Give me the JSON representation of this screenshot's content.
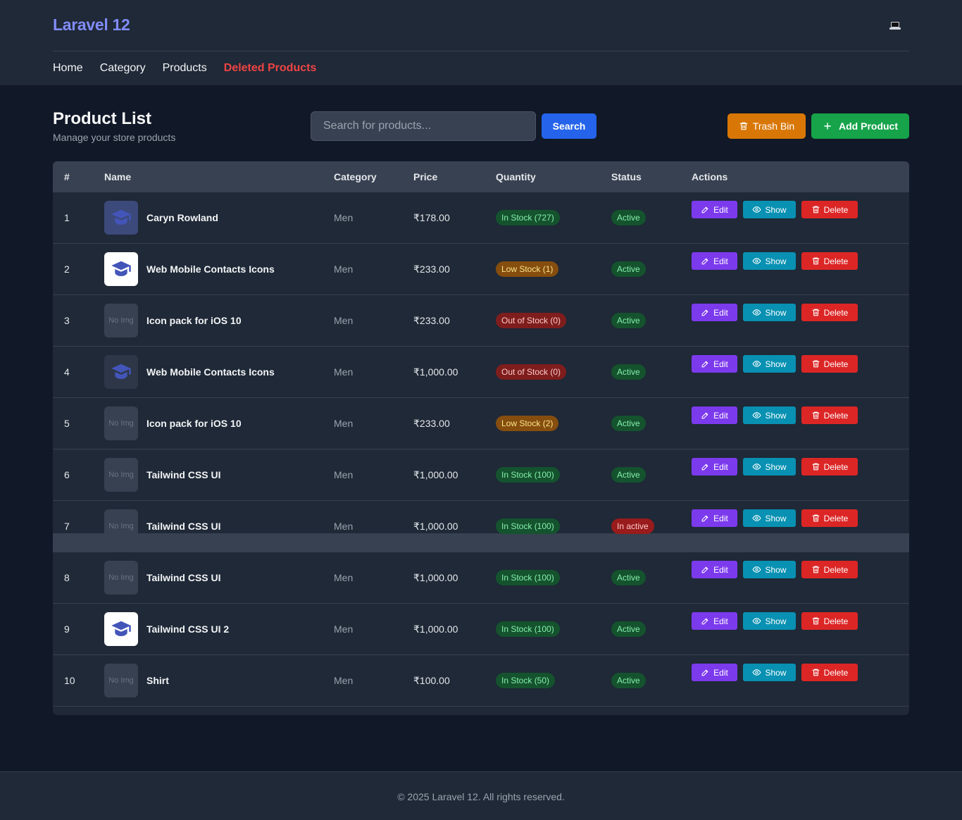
{
  "header": {
    "brand": "Laravel 12",
    "theme_toggle_icon": "laptop-icon",
    "nav": [
      {
        "label": "Home"
      },
      {
        "label": "Category"
      },
      {
        "label": "Products"
      },
      {
        "label": "Deleted Products"
      }
    ]
  },
  "page": {
    "title": "Product List",
    "subtitle": "Manage your store products",
    "search_placeholder": "Search for products...",
    "search_button": "Search",
    "trash_button": "Trash Bin",
    "add_button": "Add Product"
  },
  "table": {
    "columns": [
      "#",
      "Name",
      "Category",
      "Price",
      "Quantity",
      "Status",
      "Actions"
    ],
    "actions": {
      "edit": "Edit",
      "show": "Show",
      "delete": "Delete"
    },
    "rows": [
      {
        "num": "1",
        "image": "image",
        "name": "Caryn Rowland",
        "category": "Men",
        "price": "₹178.00",
        "quantity": "In Stock (727)",
        "quantity_level": "in",
        "status": "Active"
      },
      {
        "num": "2",
        "image": "image",
        "name": "Web Mobile Contacts Icons",
        "category": "Men",
        "price": "₹233.00",
        "quantity": "Low Stock (1)",
        "quantity_level": "low",
        "status": "Active"
      },
      {
        "num": "3",
        "image": "No Img",
        "name": "Icon pack for iOS 10",
        "category": "Men",
        "price": "₹233.00",
        "quantity": "Out of Stock (0)",
        "quantity_level": "out",
        "status": "Active"
      },
      {
        "num": "4",
        "image": "image",
        "name": "Web Mobile Contacts Icons",
        "category": "Men",
        "price": "₹1,000.00",
        "quantity": "Out of Stock (0)",
        "quantity_level": "out",
        "status": "Active"
      },
      {
        "num": "5",
        "image": "No Img",
        "name": "Icon pack for iOS 10",
        "category": "Men",
        "price": "₹233.00",
        "quantity": "Low Stock (2)",
        "quantity_level": "low",
        "status": "Active"
      },
      {
        "num": "6",
        "image": "No Img",
        "name": "Tailwind CSS UI",
        "category": "Men",
        "price": "₹1,000.00",
        "quantity": "In Stock (100)",
        "quantity_level": "in",
        "status": "Active"
      },
      {
        "num": "7",
        "image": "No Img",
        "name": "Tailwind CSS UI",
        "category": "Men",
        "price": "₹1,000.00",
        "quantity": "In Stock (100)",
        "quantity_level": "in",
        "status": "In active"
      },
      {
        "num": "8",
        "image": "No Img",
        "name": "Tailwind CSS UI",
        "category": "Men",
        "price": "₹1,000.00",
        "quantity": "In Stock (100)",
        "quantity_level": "in",
        "status": "Active"
      },
      {
        "num": "9",
        "image": "image",
        "name": "Tailwind CSS UI 2",
        "category": "Men",
        "price": "₹1,000.00",
        "quantity": "In Stock (100)",
        "quantity_level": "in",
        "status": "Active"
      },
      {
        "num": "10",
        "image": "No Img",
        "name": "Shirt",
        "category": "Men",
        "price": "₹100.00",
        "quantity": "In Stock (50)",
        "quantity_level": "in",
        "status": "Active"
      }
    ]
  },
  "footer": {
    "text": "© 2025 Laravel 12. All rights reserved."
  },
  "colors": {
    "background": "#111827",
    "panel": "#1f2937",
    "brand": "#818cf8",
    "nav_active": "#ef4444",
    "search": "#2563eb",
    "trash": "#d97706",
    "add": "#16a34a",
    "edit": "#7c3aed",
    "show": "#0891b2",
    "delete": "#dc2626"
  }
}
